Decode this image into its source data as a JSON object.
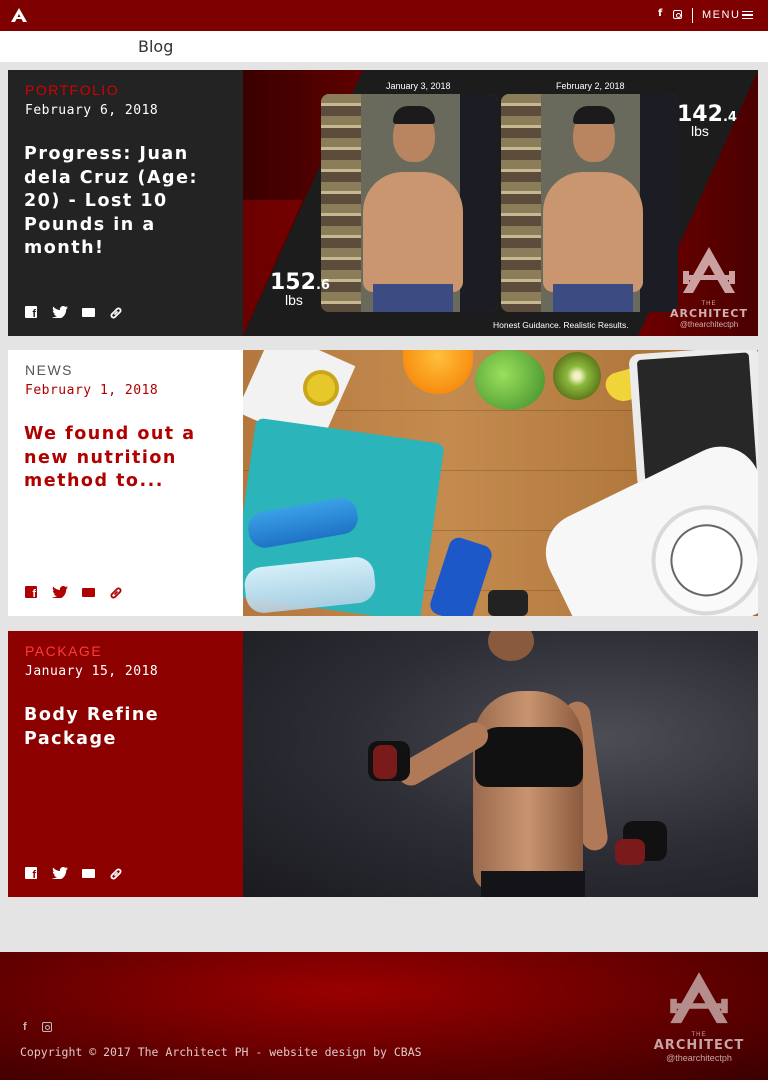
{
  "topbar": {
    "menu_label": "MENU",
    "social": [
      "facebook-icon",
      "instagram-icon"
    ]
  },
  "page": {
    "title": "Blog"
  },
  "posts": [
    {
      "category": "PORTFOLIO",
      "date": "February 6, 2018",
      "title": "Progress: Juan dela Cruz (Age: 20) - Lost 10 Pounds in a month!",
      "image": {
        "left_date": "January 3, 2018",
        "right_date": "February 2, 2018",
        "before_weight_whole": "152",
        "before_weight_decimal": ".6",
        "after_weight_whole": "142",
        "after_weight_decimal": ".4",
        "unit": "lbs",
        "tagline": "Honest Guidance. Realistic Results.",
        "brand_the": "THE",
        "brand_name": "ARCHITECT",
        "brand_handle": "@thearchitectph"
      }
    },
    {
      "category": "NEWS",
      "date": "February 1, 2018",
      "title": "We found out a new nutrition method to..."
    },
    {
      "category": "PACKAGE",
      "date": "January 15, 2018",
      "title": "Body Refine Package"
    }
  ],
  "share_icons": [
    "facebook-icon",
    "twitter-icon",
    "mail-icon",
    "link-icon"
  ],
  "colors": {
    "brand_red": "#7e0000",
    "accent_red": "#d40000",
    "dark_card": "#232323",
    "red_card": "#8c0000"
  },
  "footer": {
    "copyright": "Copyright © 2017 The Architect PH - website design by CBAS",
    "brand_the": "THE",
    "brand_name": "ARCHITECT",
    "brand_handle": "@thearchitectph"
  }
}
